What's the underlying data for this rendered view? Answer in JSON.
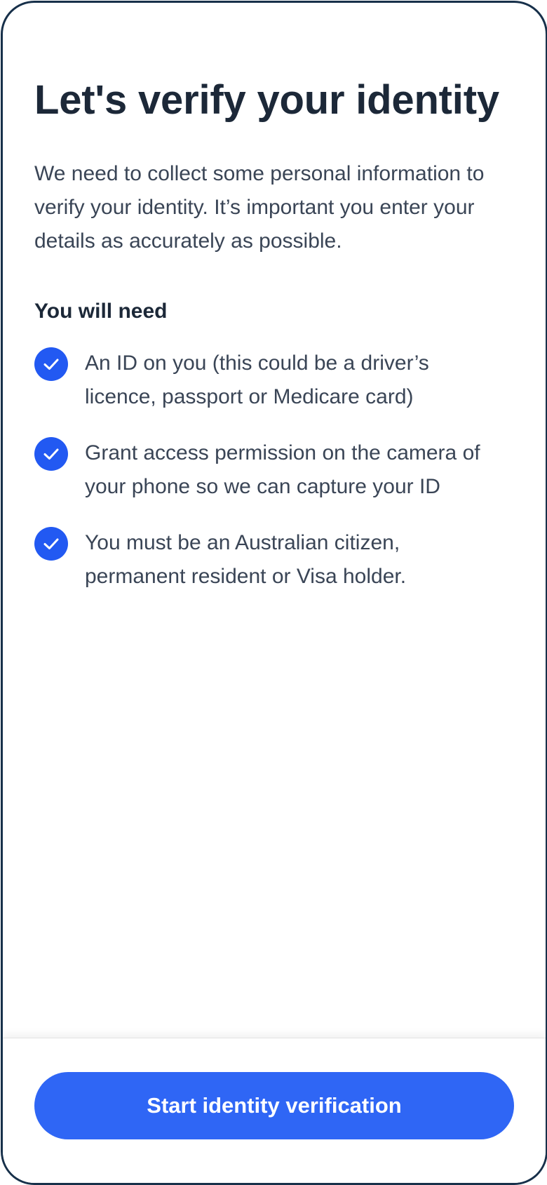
{
  "page": {
    "title": "Let's verify your identity",
    "intro": "We need to collect some personal information to verify your identity. It’s important you enter your details as accurately as possible."
  },
  "requirements": {
    "heading": "You will need",
    "items": [
      {
        "icon": "check-circle-icon",
        "text": "An ID on you (this could be a driver’s licence, passport or Medicare card)"
      },
      {
        "icon": "check-circle-icon",
        "text": "Grant access permission on the camera of your phone so we can capture your ID"
      },
      {
        "icon": "check-circle-icon",
        "text": "You must be an Australian citizen, permanent resident or Visa holder."
      }
    ]
  },
  "footer": {
    "start_button_label": "Start identity verification"
  },
  "colors": {
    "primary": "#2f66f5",
    "check": "#2259f2",
    "heading_text": "#1c2838",
    "body_text": "#3a4556",
    "frame_border": "#17304a"
  }
}
